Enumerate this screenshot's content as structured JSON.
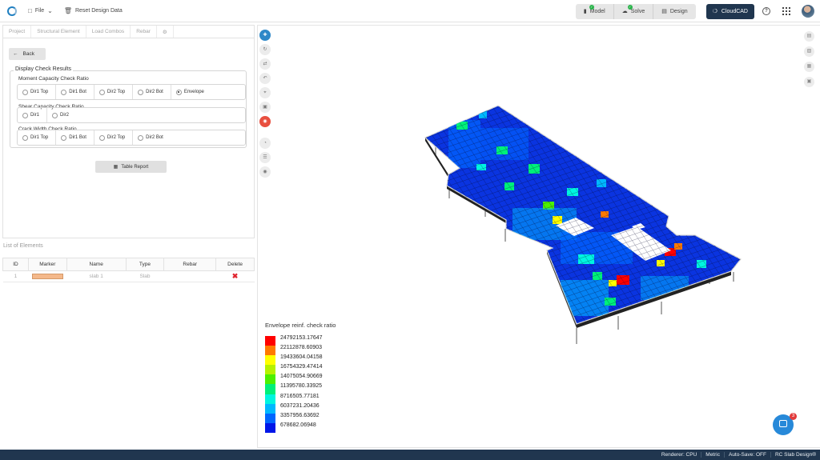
{
  "topbar": {
    "file_label": "File",
    "reset_label": "Reset Design Data",
    "steps": [
      "Model",
      "Solve",
      "Design"
    ],
    "cloud_label": "CloudCAD"
  },
  "tabs": [
    "Project",
    "Structural Element",
    "Load Combos",
    "Rebar"
  ],
  "panel": {
    "back_label": "Back",
    "display_title": "Display Check Results",
    "moment_title": "Moment Capacity Check Ratio",
    "moment_options": [
      "Dir1 Top",
      "Dir1 Bot",
      "Dir2 Top",
      "Dir2 Bot",
      "Envelope"
    ],
    "moment_selected": "Envelope",
    "shear_title": "Shear Capacity Check Ratio",
    "shear_options": [
      "Dir1",
      "Dir2"
    ],
    "crack_title": "Crack Width Check Ratio",
    "crack_options": [
      "Dir1 Top",
      "Dir1 Bot",
      "Dir2 Top",
      "Dir2 Bot"
    ],
    "report_label": "Table Report"
  },
  "elements": {
    "title": "List of Elements",
    "columns": [
      "ID",
      "Marker",
      "Name",
      "Type",
      "Rebar",
      "Delete"
    ],
    "rows": [
      {
        "id": "1",
        "name": "slab 1",
        "type": "Slab",
        "rebar": "",
        "marker_color": "#f4b88a"
      }
    ]
  },
  "legend": {
    "title": "Envelope reinf. check ratio",
    "entries": [
      {
        "value": "24792153.17647",
        "color": "#ff0000"
      },
      {
        "value": "22112878.60903",
        "color": "#ff7a00"
      },
      {
        "value": "19433604.04158",
        "color": "#ffff00"
      },
      {
        "value": "16754329.47414",
        "color": "#b6f200"
      },
      {
        "value": "14075054.90669",
        "color": "#4cf000"
      },
      {
        "value": "11395780.33925",
        "color": "#00f07a"
      },
      {
        "value": "8716505.77181",
        "color": "#00f5e0"
      },
      {
        "value": "6037231.20436",
        "color": "#00b8ff"
      },
      {
        "value": "3357956.63692",
        "color": "#0066ff"
      },
      {
        "value": "678682.06948",
        "color": "#0016e8"
      }
    ]
  },
  "chat": {
    "badge": "3"
  },
  "statusbar": [
    "Renderer: CPU",
    "Metric",
    "Auto-Save: OFF",
    "RC Slab Design®"
  ]
}
